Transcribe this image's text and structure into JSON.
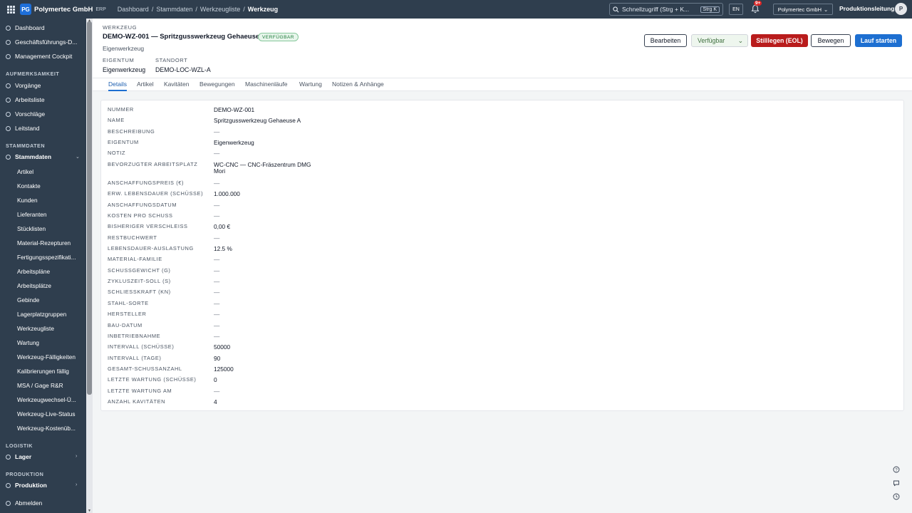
{
  "topbar": {
    "brand_badge": "PG",
    "brand_name": "Polymertec GmbH",
    "brand_sub": "ERP",
    "breadcrumb": [
      "Dashboard",
      "/",
      "Stammdaten",
      "/",
      "Werkzeugliste",
      "/",
      "Werkzeug"
    ],
    "search_placeholder": "Schnellzugriff (Strg + K...",
    "search_shortcut": "Strg K",
    "language": "EN",
    "notifications_badge": "9+",
    "company": "Polymertec GmbH",
    "role": "Produktionsleitung",
    "avatar_initial": "P"
  },
  "sidebar": {
    "top_items": [
      "Dashboard",
      "Geschäftsführungs-D...",
      "Management Cockpit"
    ],
    "section_awareness": "AUFMERKSAMKEIT",
    "awareness_items": [
      "Vorgänge",
      "Arbeitsliste",
      "Vorschläge",
      "Leitstand"
    ],
    "section_master": "STAMMDATEN",
    "master_group": "Stammdaten",
    "master_items": [
      "Artikel",
      "Kontakte",
      "Kunden",
      "Lieferanten",
      "Stücklisten",
      "Material-Rezepturen",
      "Fertigungsspezifikati...",
      "Arbeitspläne",
      "Arbeitsplätze",
      "Gebinde",
      "Lagerplatzgruppen",
      "Werkzeugliste",
      "Wartung",
      "Werkzeug-Fälligkeiten",
      "Kalibrierungen fällig",
      "MSA / Gage R&R",
      "Werkzeugwechsel-Ü...",
      "Werkzeug-Live-Status",
      "Werkzeug-Kostenüb..."
    ],
    "section_logistics": "LOGISTIK",
    "logistics_group": "Lager",
    "section_production": "PRODUKTION",
    "production_group": "Produktion",
    "logout": "Abmelden"
  },
  "header": {
    "kind": "WERKZEUG",
    "title": "DEMO-WZ-001 — Spritzgusswerkzeug Gehaeuse A",
    "status": "VERFÜGBAR",
    "subtitle": "Eigenwerkzeug",
    "owner_label": "EIGENTUM",
    "owner_value": "Eigenwerkzeug",
    "location_label": "STANDORT",
    "location_value": "DEMO-LOC-WZL-A",
    "btn_edit": "Bearbeiten",
    "status_select": "Verfügbar",
    "btn_eol": "Stilllegen (EOL)",
    "btn_move": "Bewegen",
    "btn_run": "Lauf starten"
  },
  "tabs": [
    "Details",
    "Artikel",
    "Kavitäten",
    "Bewegungen",
    "Maschinenläufe",
    "Wartung",
    "Notizen & Anhänge"
  ],
  "details": [
    {
      "label": "NUMMER",
      "value": "DEMO-WZ-001"
    },
    {
      "label": "NAME",
      "value": "Spritzgusswerkzeug Gehaeuse A"
    },
    {
      "label": "BESCHREIBUNG",
      "value": "—"
    },
    {
      "label": "EIGENTUM",
      "value": "Eigenwerkzeug"
    },
    {
      "label": "NOTIZ",
      "value": "—"
    },
    {
      "label": "BEVORZUGTER ARBEITSPLATZ",
      "value": "WC-CNC — CNC-Fräszentrum DMG",
      "value2": "Mori"
    },
    {
      "label": "ANSCHAFFUNGSPREIS (€)",
      "value": "—"
    },
    {
      "label": "ERW. LEBENSDAUER (SCHÜSSE)",
      "value": "1.000.000"
    },
    {
      "label": "ANSCHAFFUNGSDATUM",
      "value": "—"
    },
    {
      "label": "KOSTEN PRO SCHUSS",
      "value": "—"
    },
    {
      "label": "BISHERIGER VERSCHLEISS",
      "value": "0,00 €"
    },
    {
      "label": "RESTBUCHWERT",
      "value": "—"
    },
    {
      "label": "LEBENSDAUER-AUSLASTUNG",
      "value": "12.5 %"
    },
    {
      "label": "MATERIAL-FAMILIE",
      "value": "—"
    },
    {
      "label": "SCHUSSGEWICHT (G)",
      "value": "—"
    },
    {
      "label": "ZYKLUSZEIT-SOLL (S)",
      "value": "—"
    },
    {
      "label": "SCHLIESSKRAFT (KN)",
      "value": "—"
    },
    {
      "label": "STAHL-SORTE",
      "value": "—"
    },
    {
      "label": "HERSTELLER",
      "value": "—"
    },
    {
      "label": "BAU-DATUM",
      "value": "—"
    },
    {
      "label": "INBETRIEBNAHME",
      "value": "—"
    },
    {
      "label": "INTERVALL (SCHÜSSE)",
      "value": "50000"
    },
    {
      "label": "INTERVALL (TAGE)",
      "value": "90"
    },
    {
      "label": "GESAMT-SCHUSSANZAHL",
      "value": "125000"
    },
    {
      "label": "LETZTE WARTUNG (SCHÜSSE)",
      "value": "0"
    },
    {
      "label": "LETZTE WARTUNG AM",
      "value": "—"
    },
    {
      "label": "ANZAHL KAVITÄTEN",
      "value": "4"
    }
  ],
  "float_icons": [
    "help-icon",
    "chat-icon",
    "history-icon"
  ]
}
